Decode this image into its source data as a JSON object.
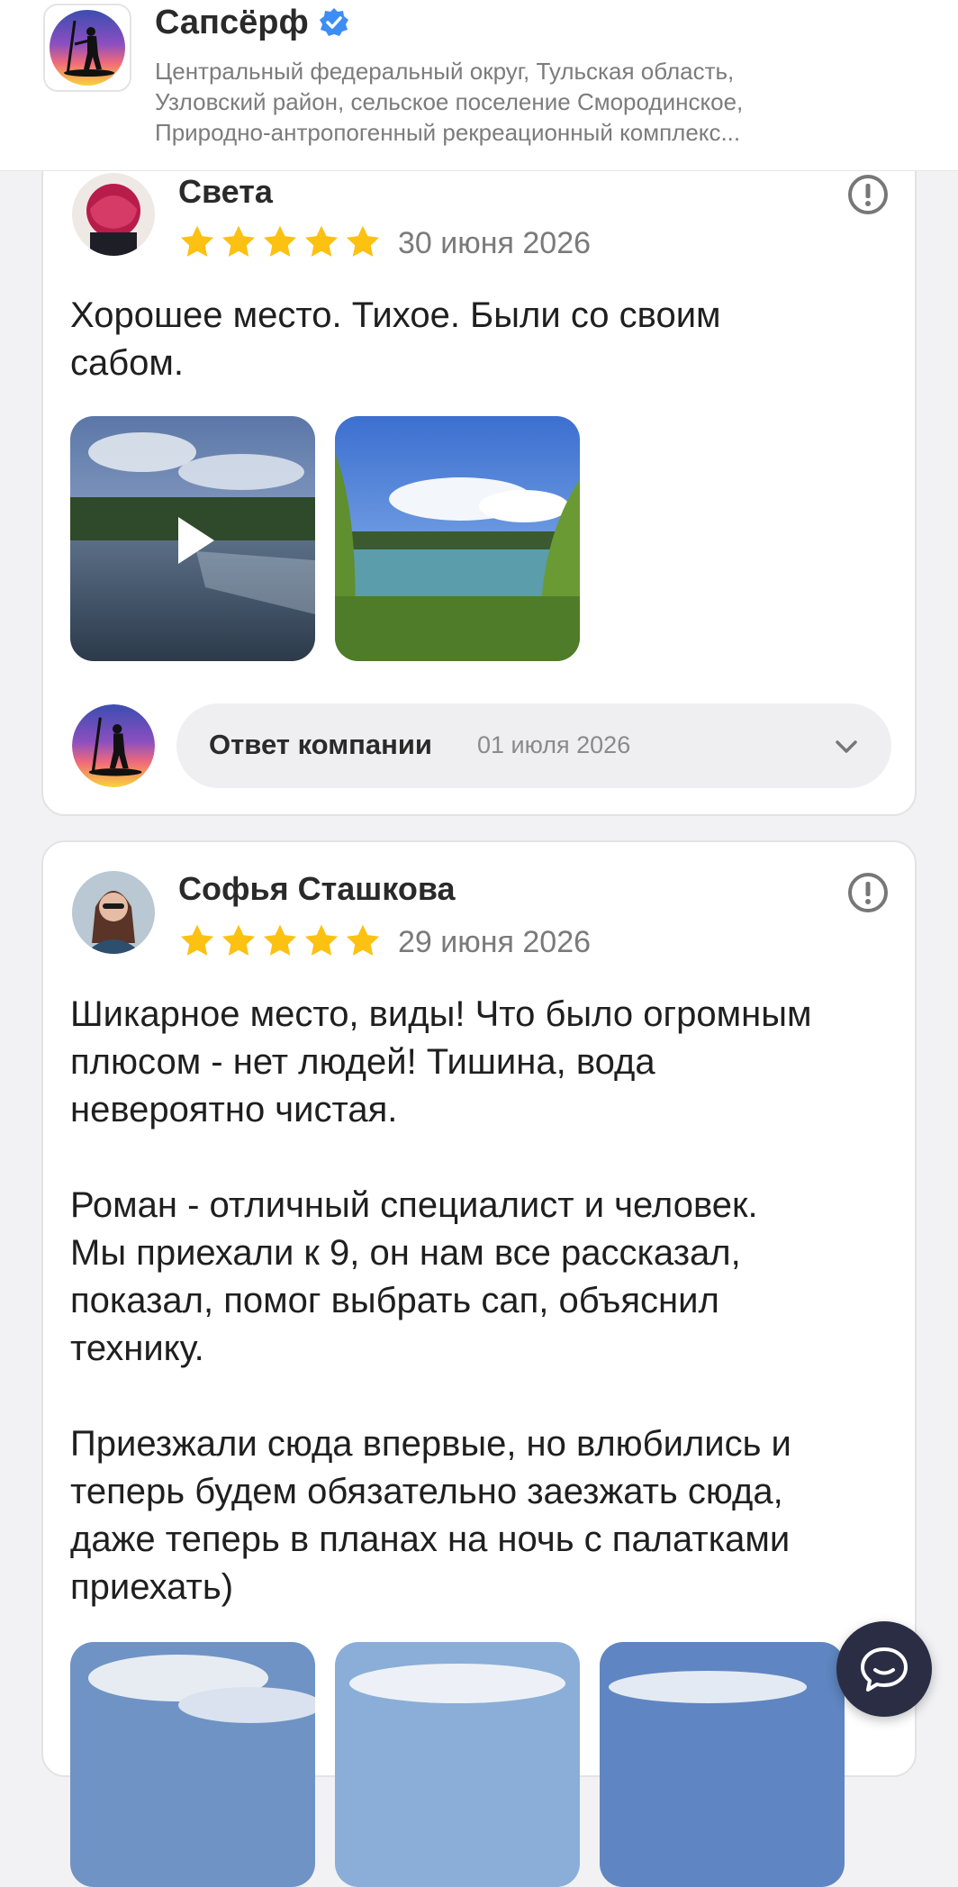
{
  "header": {
    "title": "Сапсёрф",
    "address_line1": "Центральный федеральный округ, Тульская область,",
    "address_line2": "Узловский район, сельское поселение Смородинское,",
    "address_line3": "Природно-антропогенный рекреационный комплекс..."
  },
  "reviews": [
    {
      "author": "Света",
      "rating": 5,
      "date": "30 июня 2026",
      "text": "Хорошее место. Тихое. Были со своим\nсабом.",
      "photos": [
        "lake-video",
        "lake-photo"
      ],
      "company_reply": {
        "label": "Ответ компании",
        "date": "01 июля 2026"
      }
    },
    {
      "author": "Софья Сташкова",
      "rating": 5,
      "date": "29 июня 2026",
      "text": "Шикарное место, виды! Что было огромным\nплюсом - нет людей! Тишина, вода\nневероятно чистая.\n\nРоман - отличный специалист и человек.\nМы приехали к 9, он нам все рассказал,\nпоказал, помог выбрать сап, объяснил\nтехнику.\n\nПриезжали сюда впервые, но влюбились и\nтеперь будем обязательно заезжать сюда,\nдаже теперь в планах на ночь с палатками\nприехать)"
    }
  ],
  "colors": {
    "star": "#fcc111",
    "verified": "#3d8df5",
    "fab": "#2b2d45"
  },
  "icons": [
    "verified-icon",
    "star-icon",
    "report-icon",
    "play-icon",
    "chevron-down-icon",
    "chat-icon"
  ]
}
